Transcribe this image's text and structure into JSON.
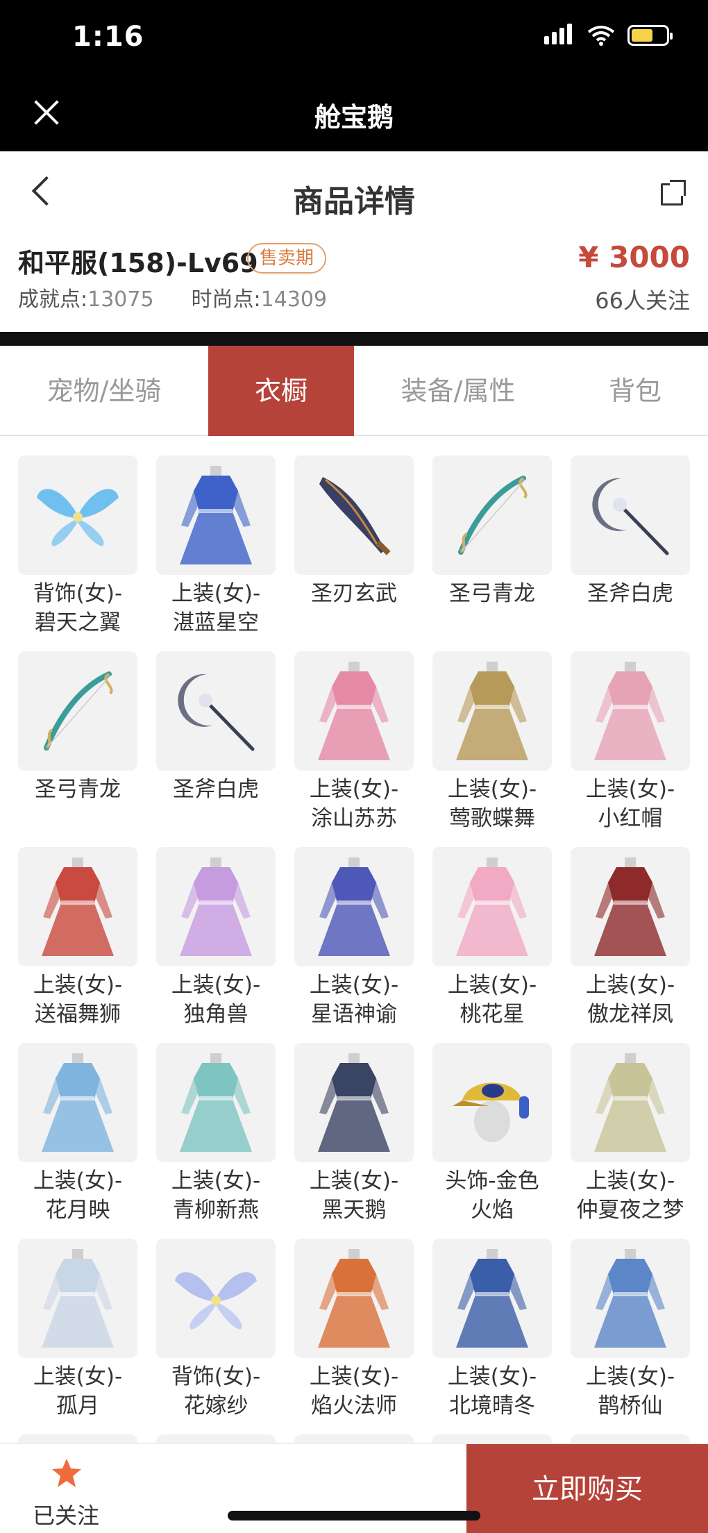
{
  "status": {
    "time": "1:16"
  },
  "app": {
    "title": "舱宝鹅"
  },
  "header": {
    "page_title": "商品详情",
    "item_title": "和平服(158)-Lv69",
    "sale_badge": "售卖期",
    "achievement_label": "成就点:",
    "achievement_value": "13075",
    "fashion_label": "时尚点:",
    "fashion_value": "14309",
    "price": "¥ 3000",
    "followers": "66人关注"
  },
  "tabs": [
    {
      "label": "宠物/坐骑",
      "active": false
    },
    {
      "label": "衣橱",
      "active": true
    },
    {
      "label": "装备/属性",
      "active": false
    },
    {
      "label": "背包",
      "active": false
    }
  ],
  "items": [
    {
      "line1": "背饰(女)-",
      "line2": "碧天之翼",
      "icon": "wings-icon",
      "color": "#58b6ee"
    },
    {
      "line1": "上装(女)-",
      "line2": "湛蓝星空",
      "icon": "dress-icon",
      "color": "#3f62c9"
    },
    {
      "line1": "圣刃玄武",
      "line2": "",
      "icon": "blade-icon",
      "color": "#3a3f66"
    },
    {
      "line1": "圣弓青龙",
      "line2": "",
      "icon": "bow-icon",
      "color": "#3a9d9a"
    },
    {
      "line1": "圣斧白虎",
      "line2": "",
      "icon": "axe-icon",
      "color": "#6b6f85"
    },
    {
      "line1": "圣弓青龙",
      "line2": "",
      "icon": "bow-icon",
      "color": "#3a9d9a"
    },
    {
      "line1": "圣斧白虎",
      "line2": "",
      "icon": "axe-icon",
      "color": "#6b6f85"
    },
    {
      "line1": "上装(女)-",
      "line2": "涂山苏苏",
      "icon": "dress-icon",
      "color": "#e58aa6"
    },
    {
      "line1": "上装(女)-",
      "line2": "莺歌蝶舞",
      "icon": "dress-icon",
      "color": "#b69a5a"
    },
    {
      "line1": "上装(女)-",
      "line2": "小红帽",
      "icon": "dress-icon",
      "color": "#e7a3b6"
    },
    {
      "line1": "上装(女)-",
      "line2": "送福舞狮",
      "icon": "dress-icon",
      "color": "#c94a3e"
    },
    {
      "line1": "上装(女)-",
      "line2": "独角兽",
      "icon": "dress-icon",
      "color": "#c79be0"
    },
    {
      "line1": "上装(女)-",
      "line2": "星语神谕",
      "icon": "dress-icon",
      "color": "#4e58b8"
    },
    {
      "line1": "上装(女)-",
      "line2": "桃花星",
      "icon": "dress-icon",
      "color": "#f1a9c4"
    },
    {
      "line1": "上装(女)-",
      "line2": "傲龙祥凤",
      "icon": "dress-icon",
      "color": "#8e2a2a"
    },
    {
      "line1": "上装(女)-",
      "line2": "花月映",
      "icon": "dress-icon",
      "color": "#7fb4de"
    },
    {
      "line1": "上装(女)-",
      "line2": "青柳新燕",
      "icon": "dress-icon",
      "color": "#7ec4c0"
    },
    {
      "line1": "上装(女)-",
      "line2": "黑天鹅",
      "icon": "dress-icon",
      "color": "#3a4563"
    },
    {
      "line1": "头饰-金色",
      "line2": "火焰",
      "icon": "cap-icon",
      "color": "#e0b93a"
    },
    {
      "line1": "上装(女)-",
      "line2": "仲夏夜之梦",
      "icon": "dress-icon",
      "color": "#c8c49a"
    },
    {
      "line1": "上装(女)-",
      "line2": "孤月",
      "icon": "dress-icon",
      "color": "#c9d6e6"
    },
    {
      "line1": "背饰(女)-",
      "line2": "花嫁纱",
      "icon": "wings-icon",
      "color": "#a9b8ec"
    },
    {
      "line1": "上装(女)-",
      "line2": "焰火法师",
      "icon": "dress-icon",
      "color": "#d8723a"
    },
    {
      "line1": "上装(女)-",
      "line2": "北境晴冬",
      "icon": "dress-icon",
      "color": "#3b5ea8"
    },
    {
      "line1": "上装(女)-",
      "line2": "鹊桥仙",
      "icon": "dress-icon",
      "color": "#5b86c8"
    }
  ],
  "bottom": {
    "follow_label": "已关注",
    "buy_label": "立即购买"
  },
  "colors": {
    "accent": "#b6433a",
    "price": "#c64a3c",
    "badge": "#d9793e",
    "star": "#f06b3b"
  }
}
